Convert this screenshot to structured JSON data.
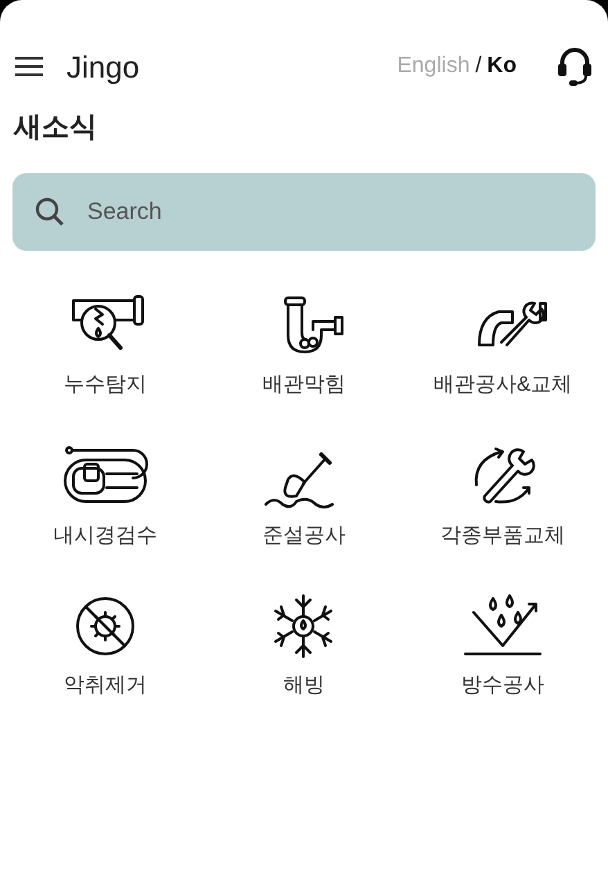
{
  "app_bar": {
    "title": "Jingo",
    "languages": [
      {
        "label": "English",
        "selected": false
      },
      {
        "label": "Ko",
        "selected": true
      }
    ],
    "separator": "/"
  },
  "section_title": "새소식",
  "search": {
    "placeholder": "Search"
  },
  "services": [
    {
      "label": "누수탐지",
      "kind": "leak"
    },
    {
      "label": "배관막힘",
      "kind": "clog"
    },
    {
      "label": "배관공사&교체",
      "kind": "pipe-wrench"
    },
    {
      "label": "내시경검수",
      "kind": "endoscope"
    },
    {
      "label": "준설공사",
      "kind": "shovel"
    },
    {
      "label": "각종부품교체",
      "kind": "wrench-cycle"
    },
    {
      "label": "악취제거",
      "kind": "no-germ"
    },
    {
      "label": "해빙",
      "kind": "snowflake"
    },
    {
      "label": "방수공사",
      "kind": "waterproof"
    }
  ]
}
